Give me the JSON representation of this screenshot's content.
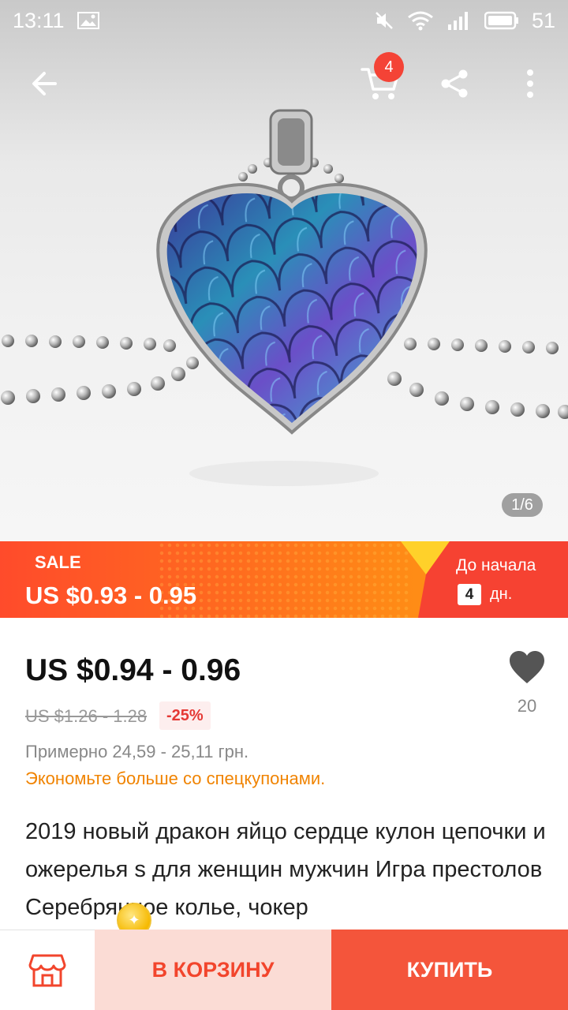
{
  "status_bar": {
    "time": "13:11",
    "battery": "51"
  },
  "top_bar": {
    "cart_count": "4"
  },
  "gallery": {
    "pager": "1/6"
  },
  "sale": {
    "label": "SALE",
    "price": "US $0.93 - 0.95",
    "countdown_label": "До начала",
    "countdown_days": "4",
    "countdown_unit": "дн."
  },
  "product": {
    "price": "US $0.94 - 0.96",
    "old_price": "US $1.26 - 1.28",
    "discount": "-25%",
    "wishlist_count": "20",
    "approx_price": "Примерно 24,59 - 25,11 грн.",
    "coupons_link": "Экономьте больше со спецкупонами.",
    "title": "2019 новый дракон яйцо сердце кулон цепочки и ожерелья s для женщин мужчин Игра престолов Серебрянное колье, чокер"
  },
  "bottom_bar": {
    "add_to_cart": "В КОРЗИНУ",
    "buy": "КУПИТЬ"
  },
  "icons": {
    "back": "arrow-left-icon",
    "cart": "cart-icon",
    "share": "share-icon",
    "more": "more-vertical-icon",
    "wishlist": "heart-icon",
    "store": "store-icon"
  },
  "colors": {
    "accent": "#f4553b",
    "sale_start": "#ff4b2b",
    "sale_end": "#ff9b12",
    "coupon_text": "#f08300"
  }
}
